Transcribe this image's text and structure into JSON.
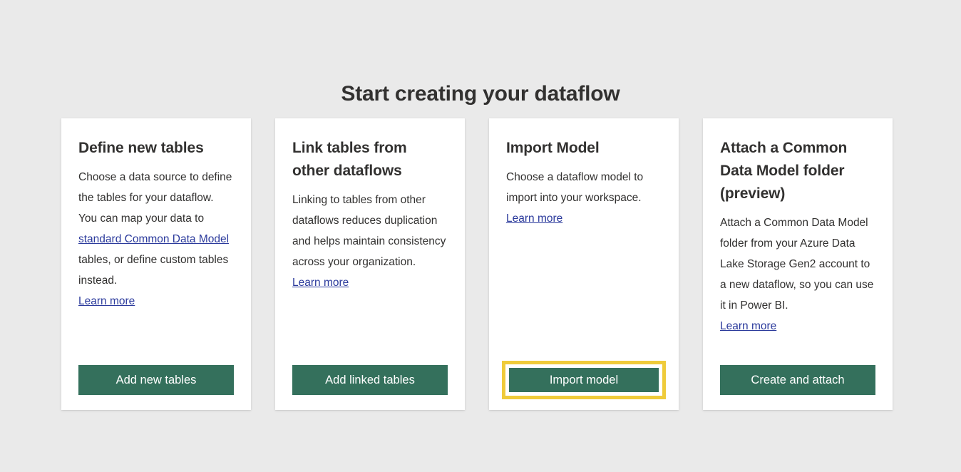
{
  "page": {
    "title": "Start creating your dataflow",
    "background_color": "#eaeaea",
    "accent_button_color": "#34705c",
    "highlight_color": "#efcb3a",
    "link_color": "#2b3a9c"
  },
  "cards": [
    {
      "title": "Define new tables",
      "desc_before_link": "Choose a data source to define the tables for your dataflow. You can map your data to ",
      "inline_link": "standard Common Data Model",
      "desc_after_link": " tables, or define custom tables instead.",
      "learn_more": "Learn more",
      "button_label": "Add new tables",
      "highlighted": false
    },
    {
      "title": "Link tables from other dataflows",
      "description": "Linking to tables from other dataflows reduces duplication and helps maintain consistency across your organization.",
      "learn_more": "Learn more",
      "button_label": "Add linked tables",
      "highlighted": false
    },
    {
      "title": "Import Model",
      "description": "Choose a dataflow model to import into your workspace.",
      "learn_more": "Learn more",
      "button_label": "Import model",
      "highlighted": true
    },
    {
      "title": "Attach a Common Data Model folder (preview)",
      "description": "Attach a Common Data Model folder from your Azure Data Lake Storage Gen2 account to a new dataflow, so you can use it in Power BI.",
      "learn_more": "Learn more",
      "button_label": "Create and attach",
      "highlighted": false
    }
  ]
}
